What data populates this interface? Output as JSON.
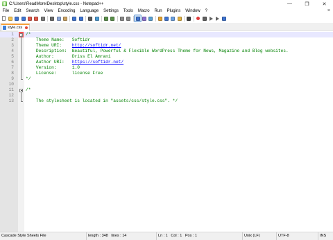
{
  "window": {
    "title": "C:\\Users\\ReadMore\\Desktop\\style.css - Notepad++",
    "minimize_glyph": "—",
    "maximize_glyph": "❐",
    "close_glyph": "✕"
  },
  "menu": {
    "items": [
      "File",
      "Edit",
      "Search",
      "View",
      "Encoding",
      "Language",
      "Settings",
      "Tools",
      "Macro",
      "Run",
      "Plugins",
      "Window",
      "?"
    ],
    "close_glyph": "×"
  },
  "toolbar": {
    "icons": [
      "new-file-icon",
      "open-file-icon",
      "save-icon",
      "save-all-icon",
      "close-icon",
      "close-all-icon",
      "print-icon",
      "|",
      "cut-icon",
      "copy-icon",
      "paste-icon",
      "|",
      "undo-icon",
      "redo-icon",
      "|",
      "find-icon",
      "replace-icon",
      "|",
      "zoom-in-icon",
      "zoom-out-icon",
      "|",
      "sync-vertical-icon",
      "sync-horizontal-icon",
      "|",
      "word-wrap-icon",
      "show-all-chars-icon",
      "indent-guide-icon",
      "|",
      "define-language-icon",
      "doc-map-icon",
      "function-list-icon",
      "folder-workspace-icon",
      "|",
      "monitoring-icon",
      "|",
      "record-macro-icon",
      "stop-record-icon",
      "play-macro-icon",
      "run-macro-multiple-icon",
      "save-macro-icon"
    ],
    "active": [
      "word-wrap-icon"
    ]
  },
  "tab": {
    "label": "style.css"
  },
  "editor": {
    "lines": [
      {
        "n": "1",
        "text": "/*"
      },
      {
        "n": "2",
        "text": "    Theme Name:   Softidr"
      },
      {
        "n": "3",
        "text": "    Theme URI:    ",
        "link": "http://softidr.net/"
      },
      {
        "n": "4",
        "text": "    Description:  Beautiful, Powerful & Flexible WordPress Theme for News, Magazine and Blog websites."
      },
      {
        "n": "5",
        "text": "    Author:       Driss El Amrani"
      },
      {
        "n": "6",
        "text": "    Author URI:   ",
        "link": "https://softidr.net/"
      },
      {
        "n": "7",
        "text": "    Version:      1.0"
      },
      {
        "n": "8",
        "text": "    License:      license Free"
      },
      {
        "n": "9",
        "text": "*/"
      },
      {
        "n": "10",
        "text": ""
      },
      {
        "n": "11",
        "text": "/*"
      },
      {
        "n": "12",
        "text": ""
      },
      {
        "n": "13",
        "text": "    The stylesheet is located in \"assets/css/style.css\". */"
      }
    ]
  },
  "status": {
    "filetype": "Cascade Style Sheets File",
    "length": "length : 348",
    "lines": "lines : 14",
    "ln": "Ln : 1",
    "col": "Col : 1",
    "pos": "Pos : 1",
    "eol": "Unix (LF)",
    "encoding": "UTF-8",
    "mode": "INS"
  }
}
